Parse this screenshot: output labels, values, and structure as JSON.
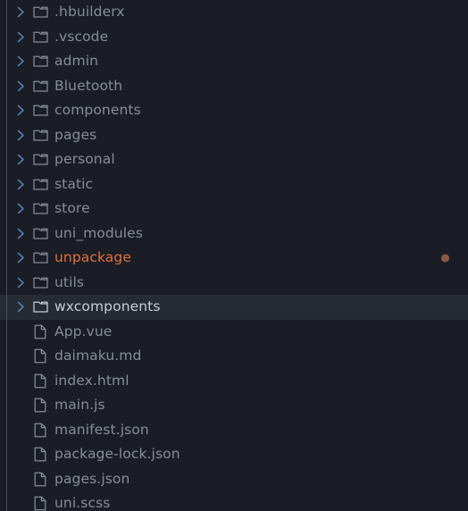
{
  "explorer": {
    "background_color": "#1a1d25",
    "selected_background_color": "#262a33",
    "text_color": "#878d98",
    "selected_text_color": "#c9cdd5",
    "ignored_text_color": "#e2703c",
    "badge_color": "#8c5a46",
    "chevron_color": "#5b7ba8",
    "icon_color": "#878d98",
    "rows": [
      {
        "label": ".hbuilderx",
        "kind": "folder",
        "expanded": false,
        "selected": false,
        "ignored": false,
        "badge": false
      },
      {
        "label": ".vscode",
        "kind": "folder",
        "expanded": false,
        "selected": false,
        "ignored": false,
        "badge": false
      },
      {
        "label": "admin",
        "kind": "folder",
        "expanded": false,
        "selected": false,
        "ignored": false,
        "badge": false
      },
      {
        "label": "Bluetooth",
        "kind": "folder",
        "expanded": false,
        "selected": false,
        "ignored": false,
        "badge": false
      },
      {
        "label": "components",
        "kind": "folder",
        "expanded": false,
        "selected": false,
        "ignored": false,
        "badge": false
      },
      {
        "label": "pages",
        "kind": "folder",
        "expanded": false,
        "selected": false,
        "ignored": false,
        "badge": false
      },
      {
        "label": "personal",
        "kind": "folder",
        "expanded": false,
        "selected": false,
        "ignored": false,
        "badge": false
      },
      {
        "label": "static",
        "kind": "folder",
        "expanded": false,
        "selected": false,
        "ignored": false,
        "badge": false
      },
      {
        "label": "store",
        "kind": "folder",
        "expanded": false,
        "selected": false,
        "ignored": false,
        "badge": false
      },
      {
        "label": "uni_modules",
        "kind": "folder",
        "expanded": false,
        "selected": false,
        "ignored": false,
        "badge": false
      },
      {
        "label": "unpackage",
        "kind": "folder",
        "expanded": false,
        "selected": false,
        "ignored": true,
        "badge": true
      },
      {
        "label": "utils",
        "kind": "folder",
        "expanded": false,
        "selected": false,
        "ignored": false,
        "badge": false
      },
      {
        "label": "wxcomponents",
        "kind": "folder",
        "expanded": false,
        "selected": true,
        "ignored": false,
        "badge": false
      },
      {
        "label": "App.vue",
        "kind": "file",
        "expanded": false,
        "selected": false,
        "ignored": false,
        "badge": false
      },
      {
        "label": "daimaku.md",
        "kind": "file",
        "expanded": false,
        "selected": false,
        "ignored": false,
        "badge": false
      },
      {
        "label": "index.html",
        "kind": "file",
        "expanded": false,
        "selected": false,
        "ignored": false,
        "badge": false
      },
      {
        "label": "main.js",
        "kind": "file",
        "expanded": false,
        "selected": false,
        "ignored": false,
        "badge": false
      },
      {
        "label": "manifest.json",
        "kind": "file",
        "expanded": false,
        "selected": false,
        "ignored": false,
        "badge": false
      },
      {
        "label": "package-lock.json",
        "kind": "file",
        "expanded": false,
        "selected": false,
        "ignored": false,
        "badge": false
      },
      {
        "label": "pages.json",
        "kind": "file",
        "expanded": false,
        "selected": false,
        "ignored": false,
        "badge": false
      },
      {
        "label": "uni.scss",
        "kind": "file",
        "expanded": false,
        "selected": false,
        "ignored": false,
        "badge": false
      }
    ]
  }
}
